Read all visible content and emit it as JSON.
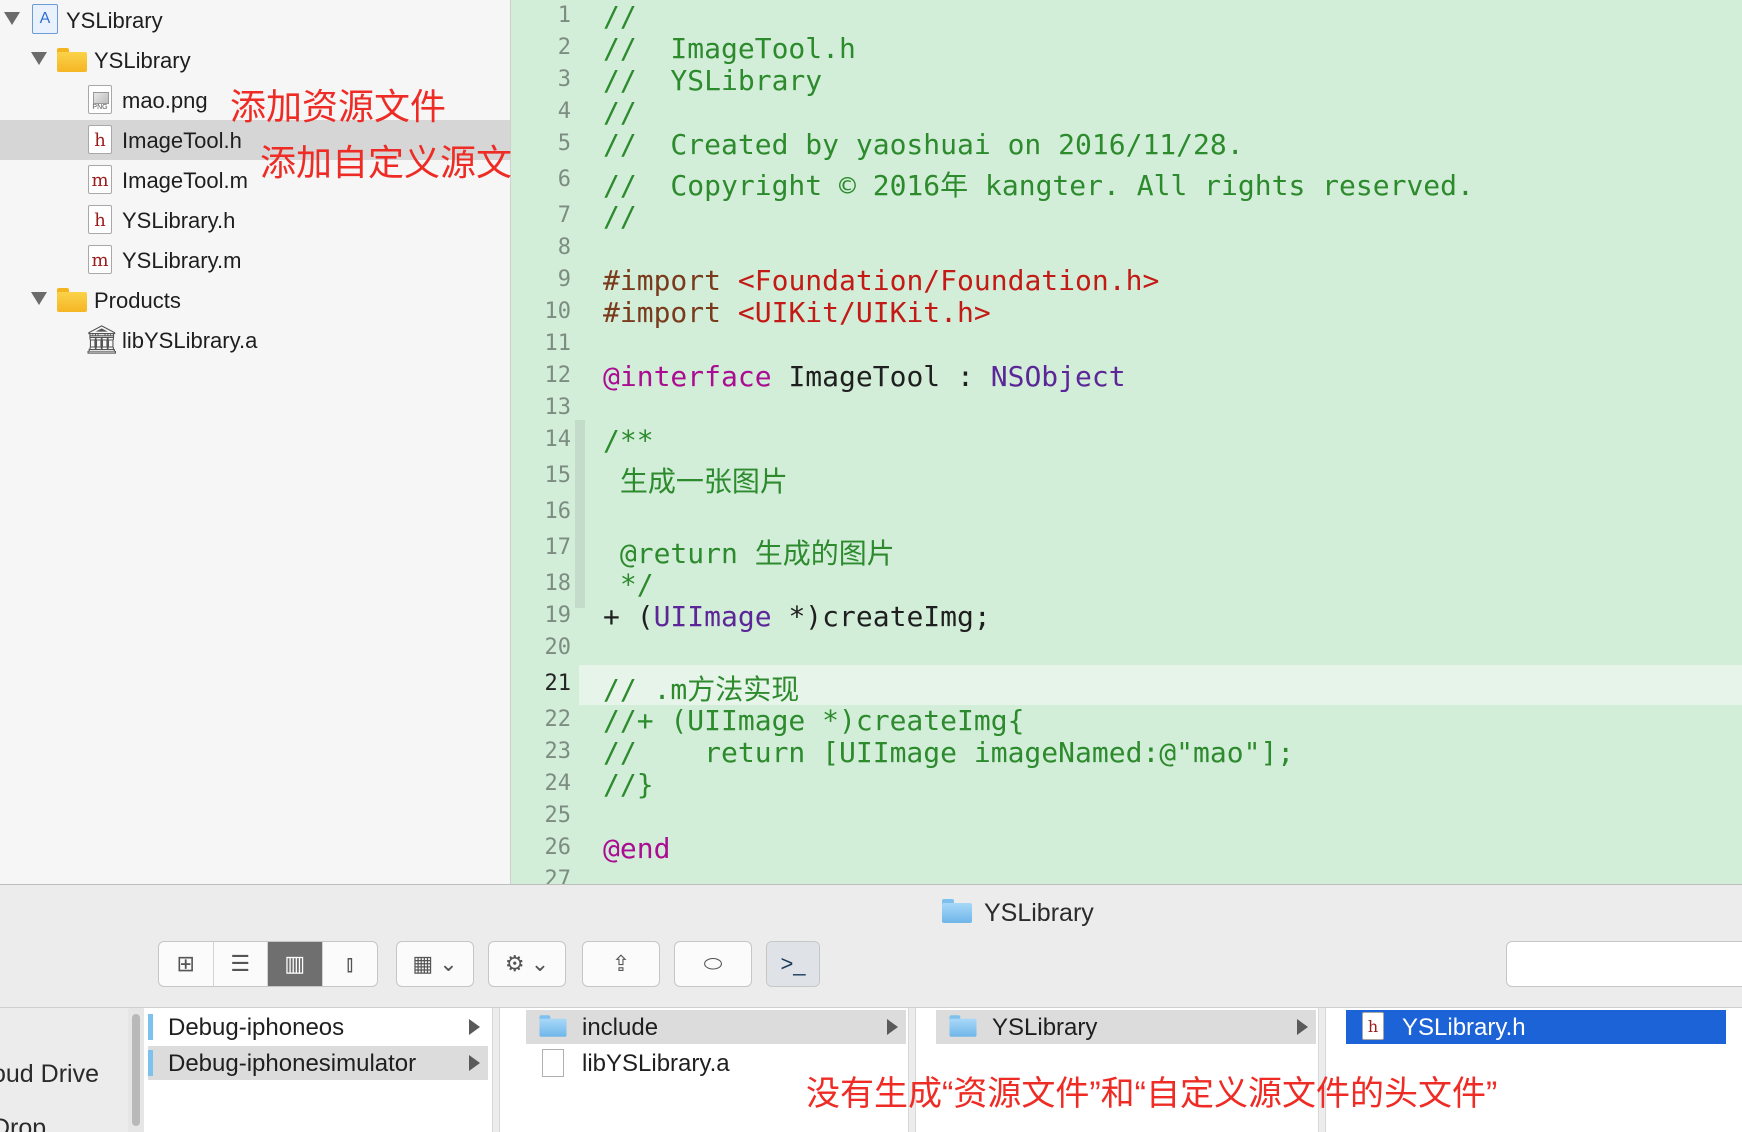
{
  "navigator": {
    "items": [
      {
        "label": "YSLibrary",
        "kind": "project"
      },
      {
        "label": "YSLibrary",
        "kind": "folder"
      },
      {
        "label": "mao.png",
        "kind": "png"
      },
      {
        "label": "ImageTool.h",
        "kind": "h",
        "selected": true
      },
      {
        "label": "ImageTool.m",
        "kind": "m"
      },
      {
        "label": "YSLibrary.h",
        "kind": "h"
      },
      {
        "label": "YSLibrary.m",
        "kind": "m"
      },
      {
        "label": "Products",
        "kind": "folder"
      },
      {
        "label": "libYSLibrary.a",
        "kind": "library"
      }
    ],
    "annotation_resource": "添加资源文件",
    "annotation_custom_source": "添加自定义源文件"
  },
  "icons": {
    "h_file": "h-file-icon",
    "m_file": "m-file-icon",
    "png_file": "png-file-icon",
    "folder": "folder-icon",
    "project": "xcode-project-icon",
    "library": "static-library-icon"
  },
  "editor": {
    "line_numbers": [
      "1",
      "2",
      "3",
      "4",
      "5",
      "6",
      "7",
      "8",
      "9",
      "10",
      "11",
      "12",
      "13",
      "14",
      "15",
      "16",
      "17",
      "18",
      "19",
      "20",
      "21",
      "22",
      "23",
      "24",
      "25",
      "26",
      "27"
    ],
    "current_line": "21",
    "code": {
      "l1": "//",
      "l2": "//  ImageTool.h",
      "l3": "//  YSLibrary",
      "l4": "//",
      "l5": "//  Created by yaoshuai on 2016/11/28.",
      "l6": "//  Copyright © 2016年 kangter. All rights reserved.",
      "l7": "//",
      "l9_dir": "#import",
      "l9_str": "<Foundation/Foundation.h>",
      "l10_dir": "#import",
      "l10_str": "<UIKit/UIKit.h>",
      "l12_kw": "@interface",
      "l12_name": "ImageTool",
      "l12_colon": ":",
      "l12_cls": "NSObject",
      "l14": "/**",
      "l15": " 生成一张图片",
      "l17": " @return 生成的图片",
      "l18": " */",
      "l19_a": "+ (",
      "l19_cls": "UIImage",
      "l19_b": " *)createImg;",
      "l21": "// .m方法实现",
      "l22": "//+ (UIImage *)createImg{",
      "l23": "//    return [UIImage imageNamed:@\"mao\"];",
      "l24": "//}",
      "l26": "@end"
    },
    "colors": {
      "background": "#d2eed9",
      "comment": "#2d8a2d",
      "keyword": "#aa0d91",
      "string": "#c41a16",
      "class": "#5c2699"
    }
  },
  "finder": {
    "title": "YSLibrary",
    "toolbar": {
      "view_icon": "icon-view-icon",
      "list_icon": "list-view-icon",
      "column_icon": "column-view-icon",
      "coverflow_icon": "cover-flow-icon",
      "group_icon": "arrange-icon",
      "action_icon": "gear-icon",
      "share_icon": "share-icon",
      "tag_icon": "tag-icon",
      "terminal_icon": "terminal-icon"
    },
    "sidebar": {
      "item1": "oud Drive",
      "item2": "Drop"
    },
    "columns": [
      {
        "items": [
          {
            "label": "Debug-iphoneos",
            "folder": true
          },
          {
            "label": "Debug-iphonesimulator",
            "folder": true,
            "selected": true
          }
        ]
      },
      {
        "items": [
          {
            "label": "include",
            "folder": true,
            "selected": true
          },
          {
            "label": "libYSLibrary.a",
            "folder": false
          }
        ]
      },
      {
        "items": [
          {
            "label": "YSLibrary",
            "folder": true,
            "selected": true
          }
        ]
      },
      {
        "items": [
          {
            "label": "YSLibrary.h",
            "folder": false,
            "selected": true
          }
        ]
      }
    ],
    "annotation": "没有生成“资源文件”和“自定义源文件的头文件”"
  }
}
